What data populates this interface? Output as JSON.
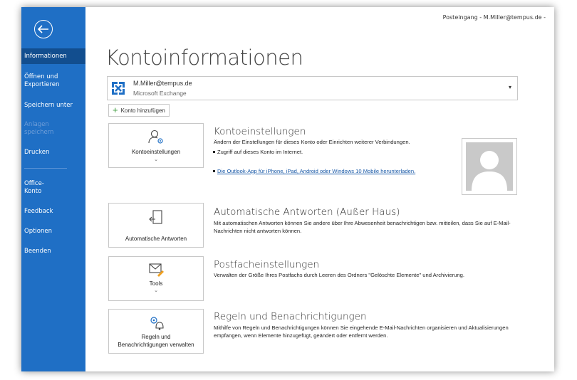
{
  "window": {
    "title": "Posteingang - M.Miller@tempus.de -"
  },
  "sidebar": {
    "back_icon": "back-arrow-icon",
    "items": [
      {
        "label": "Informationen",
        "state": "active"
      },
      {
        "label": "Öffnen und\nExportieren",
        "state": "normal"
      },
      {
        "label": "Speichern unter",
        "state": "normal"
      },
      {
        "label": "Anlagen\nspeichern",
        "state": "disabled"
      },
      {
        "label": "Drucken",
        "state": "normal"
      },
      {
        "label": "Office-\nKonto",
        "state": "normal"
      },
      {
        "label": "Feedback",
        "state": "normal"
      },
      {
        "label": "Optionen",
        "state": "normal"
      },
      {
        "label": "Beenden",
        "state": "normal"
      }
    ],
    "colors": {
      "background": "#1f6fc5",
      "active": "#124e8f"
    }
  },
  "main": {
    "title": "Kontoinformationen",
    "account": {
      "email": "M.Miller@tempus.de",
      "type": "Microsoft Exchange",
      "icon": "exchange-icon"
    },
    "add_account_label": "Konto hinzufügen",
    "sections": [
      {
        "tile_label": "Kontoeinstellungen",
        "tile_icon": "account-settings-icon",
        "has_chevron": true,
        "title": "Kontoeinstellungen",
        "description": "Ändern der Einstellungen für dieses Konto oder Einrichten weiterer Verbindungen.",
        "bullets": [
          {
            "text": "Zugriff auf dieses Konto im Internet.",
            "link": false
          },
          {
            "text": "Die Outlook-App für iPhone, iPad, Android oder Windows 10 Mobile herunterladen.",
            "link": true
          }
        ]
      },
      {
        "tile_label": "Automatische Antworten",
        "tile_icon": "automatic-replies-icon",
        "has_chevron": false,
        "title": "Automatische Antworten (Außer Haus)",
        "description": "Mit automatischen Antworten können Sie andere über Ihre Abwesenheit benachrichtigen bzw. mitteilen, dass Sie auf E-Mail-Nachrichten nicht antworten können."
      },
      {
        "tile_label": "Tools",
        "tile_icon": "tools-icon",
        "has_chevron": true,
        "title": "Postfacheinstellungen",
        "description": "Verwalten der Größe Ihres Postfachs durch Leeren des Ordners \"Gelöschte Elemente\" und Archivierung."
      },
      {
        "tile_label": "Regeln und\nBenachrichtigungen verwalten",
        "tile_icon": "rules-alerts-icon",
        "has_chevron": false,
        "title": "Regeln und Benachrichtigungen",
        "description": "Mithilfe von Regeln und Benachrichtigungen können Sie eingehende E-Mail-Nachrichten organisieren und Aktualisierungen empfangen, wenn Elemente hinzugefügt, geändert oder entfernt werden."
      }
    ],
    "avatar_icon": "profile-placeholder-icon"
  }
}
